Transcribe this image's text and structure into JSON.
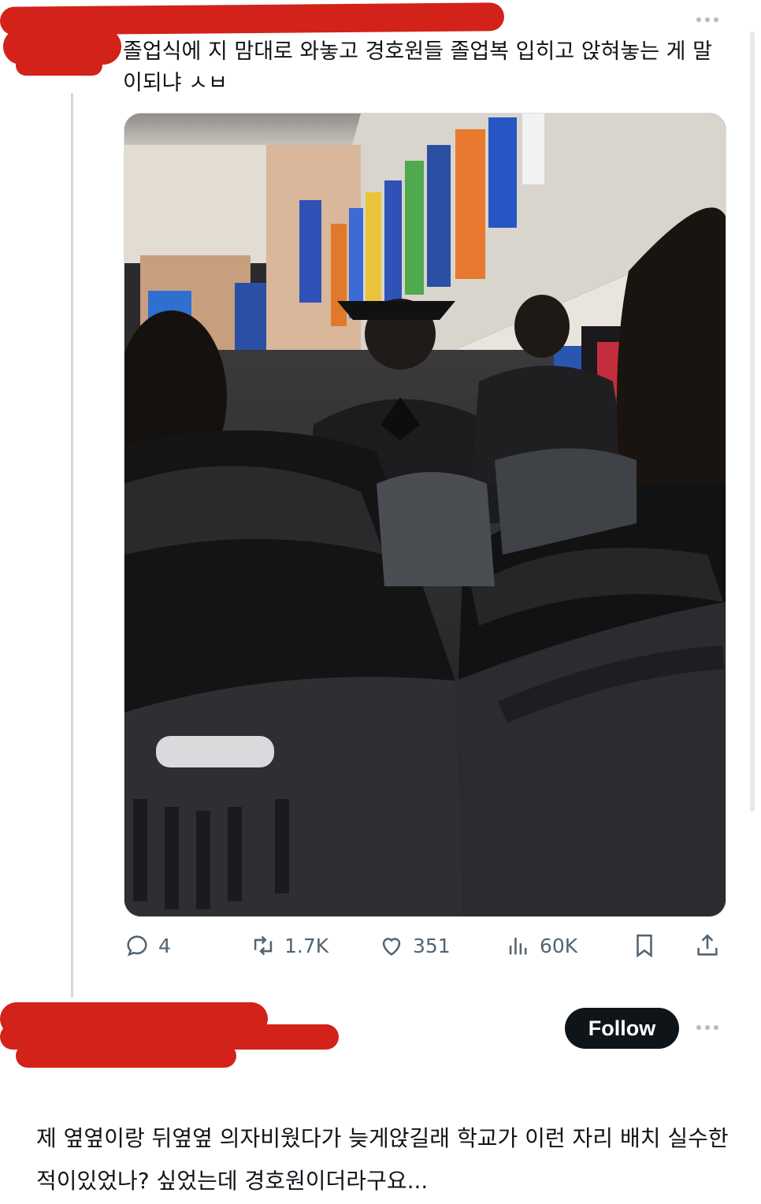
{
  "post": {
    "text": "졸업식에 지 맘대로 와놓고 경호원들 졸업복 입히고 앉혀놓는 게 말이되냐 ㅅㅂ",
    "stats": {
      "replies": "4",
      "reposts": "1.7K",
      "likes": "351",
      "views": "60K"
    }
  },
  "reply": {
    "follow_label": "Follow",
    "text": "제 옆옆이랑 뒤옆옆 의자비웠다가 늦게앉길래 학교가 이런 자리 배치 실수한적이있었나? 싶었는데 경호원이더라구요..."
  },
  "icons": [
    "more-icon",
    "reply-icon",
    "repost-icon",
    "like-icon",
    "views-icon",
    "bookmark-icon",
    "share-icon"
  ],
  "colors": {
    "redaction": "#d2221a",
    "icon_gray": "#536471",
    "follow_bg": "#0f1419",
    "thread_line": "#cfd9de"
  }
}
